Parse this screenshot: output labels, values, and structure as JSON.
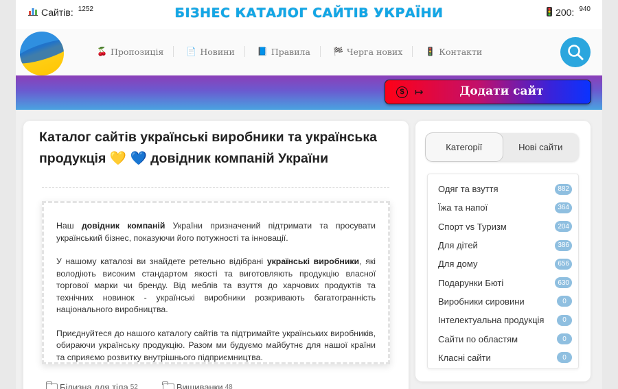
{
  "topbar": {
    "sites_icon": "bar-chart-icon",
    "sites_label": "Сайтів:",
    "sites_count": "1252",
    "title": "БІЗНЕС КАТАЛОГ САЙТІВ УКРАЇНИ",
    "status_icon": "traffic-light-icon",
    "status_label": "200:",
    "status_count": "940"
  },
  "nav": {
    "items": [
      {
        "icon": "🍒",
        "label": "Пропозиція"
      },
      {
        "icon": "📄",
        "label": "Новини"
      },
      {
        "icon": "📘",
        "label": "Правила"
      },
      {
        "icon": "🏁",
        "label": "Черга нових"
      },
      {
        "icon": "🚦",
        "label": "Контакти"
      }
    ]
  },
  "banner": {
    "add_site_label": "Додати сайт",
    "coin_symbol": "$",
    "arrow_symbol": "↦"
  },
  "main": {
    "title": "Каталог сайтів українські виробники та українська продукція 💛 💙 довідник компаній України",
    "p1_a": "Наш ",
    "p1_bold": "довідник компаній",
    "p1_b": " України призначений підтримати та просувати український бізнес, показуючи його потужності та інновації.",
    "p2_a": "У нашому каталозі ви знайдете ретельно відібрані ",
    "p2_bold": "українські виробники",
    "p2_b": ", які володіють високим стандартом якості та виготовляють продукцію власної торгової марки чи бренду. Від меблів та взуття до харчових продуктів та технічних новинок - українські виробники розкривають багатогранність національного виробництва.",
    "p3": "Приєднуйтеся до нашого каталогу сайтів та підтримайте українських виробників, обираючи українську продукцію. Разом ми будуємо майбутнє для нашої країни та сприяємо розвитку внутрішнього підприємництва.",
    "category_links": [
      {
        "label": "Білизна для тіла",
        "count": "52"
      },
      {
        "label": "Вишиванки",
        "count": "48"
      }
    ]
  },
  "sidebar": {
    "tabs": [
      "Категорії",
      "Нові сайти"
    ],
    "active_tab": "Категорії",
    "categories": [
      {
        "label": "Одяг та взуття",
        "count": "882"
      },
      {
        "label": "Їжа та напої",
        "count": "364"
      },
      {
        "label": "Спорт vs Туризм",
        "count": "204"
      },
      {
        "label": "Для дітей",
        "count": "386"
      },
      {
        "label": "Для дому",
        "count": "656"
      },
      {
        "label": "Подарунки Бюті",
        "count": "630"
      },
      {
        "label": "Виробники сировини",
        "count": "0"
      },
      {
        "label": "Інтелектуальна продукція",
        "count": "0"
      },
      {
        "label": "Сайти по областям",
        "count": "0"
      },
      {
        "label": "Класні сайти",
        "count": "0"
      }
    ]
  }
}
